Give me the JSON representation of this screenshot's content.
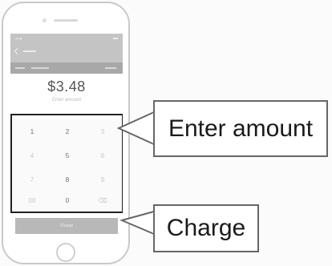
{
  "phone": {
    "status": {
      "left": "▪▪ ▸",
      "right": "▬"
    },
    "screen_amount": "$3.48",
    "amount_caption": "Enter amount",
    "keypad": {
      "keys": [
        "1",
        "2",
        "3",
        "4",
        "5",
        "6",
        "7",
        "8",
        "9",
        "00",
        "0",
        "⌫"
      ]
    },
    "charge_label": "Charge"
  },
  "callouts": {
    "enter_amount": "Enter amount",
    "charge": "Charge"
  },
  "colors": {
    "appbar": "#c4c4c4",
    "subbar": "#a8a8a8",
    "charge_button": "#b8b8b8",
    "highlight_border": "#222222"
  },
  "icons": [
    "back-icon",
    "home-button-icon",
    "camera-icon",
    "speaker-icon"
  ]
}
